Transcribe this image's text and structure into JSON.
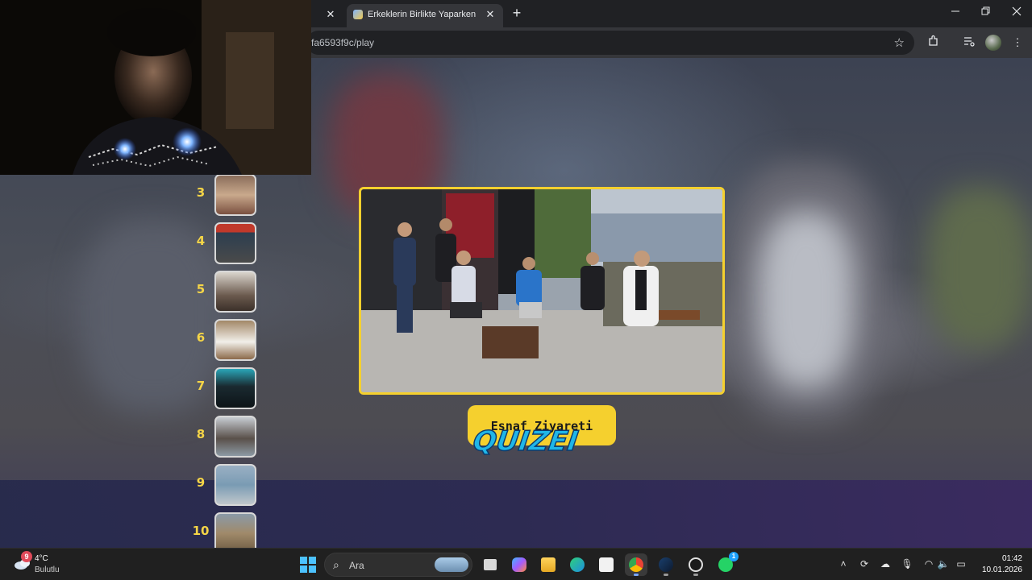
{
  "browser": {
    "active_tab_title": "Erkeklerin Birlikte Yaparken En K",
    "url_fragment": "fa6593f9c/play",
    "new_tab_symbol": "+",
    "close_symbol": "✕"
  },
  "quiz": {
    "ranks": [
      {
        "number": "3"
      },
      {
        "number": "4"
      },
      {
        "number": "5"
      },
      {
        "number": "6"
      },
      {
        "number": "7"
      },
      {
        "number": "8"
      },
      {
        "number": "9"
      },
      {
        "number": "10"
      }
    ],
    "caption": "Esnaf Ziyareti",
    "logo_text": "QUIZEI",
    "accent_color": "#f5d02e",
    "rank_color": "#f5d547"
  },
  "taskbar": {
    "weather_temp": "4°C",
    "weather_desc": "Bulutlu",
    "weather_badge": "9",
    "search_placeholder": "Ara",
    "whatsapp_badge": "1",
    "clock_time": "01:42",
    "clock_date": "10.01.2026"
  }
}
